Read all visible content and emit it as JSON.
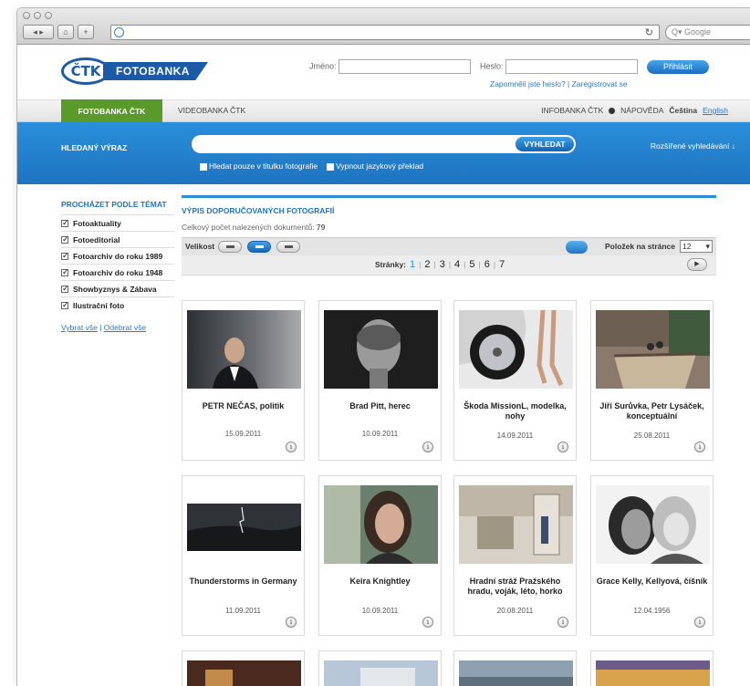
{
  "browser": {
    "search_placeholder": "Q▾ Google"
  },
  "header": {
    "logo_mark": "ČTK",
    "logo_text": "FOTOBANKA",
    "name_label": "Jméno:",
    "password_label": "Heslo:",
    "login_button": "Přihlásit",
    "forgot_link": "Zapomněli jste heslo? | Zaregistrovat se"
  },
  "nav": {
    "tab_active": "FOTOBANKA ČTK",
    "tab_video": "VIDEOBANKA ČTK",
    "infobanka": "INFOBANKA ČTK",
    "help": "NÁPOVĚDA",
    "lang_cz": "Čeština",
    "lang_en": "English"
  },
  "search": {
    "label": "HLEDANÝ VÝRAZ",
    "button": "VYHLEDAT",
    "option1": "Hledat pouze v titulku fotografie",
    "option2": "Vypnout jazykový překlad",
    "advanced": "Rozšířené vyhledávání ↓"
  },
  "sidebar": {
    "title": "PROCHÁZET PODLE TÉMAT",
    "items": [
      "Fotoaktuality",
      "Fotoeditorial",
      "Fotoarchiv do roku 1989",
      "Fotoarchiv do roku 1948",
      "Showbyznys & Zábava",
      "Ilustrační foto"
    ],
    "select_all": "Vybrat vše",
    "deselect_all": "Odebrat vše"
  },
  "main": {
    "title": "VÝPIS DOPORUČOVANÝCH FOTOGRAFIÍ",
    "count_label": "Celkový počet nalezených dokumentů:",
    "count_value": "79",
    "size_label": "Velikost",
    "per_page_label": "Položek na stránce",
    "per_page_value": "12",
    "pages_label": "Stránky:",
    "pages": [
      "1",
      "2",
      "3",
      "4",
      "5",
      "6",
      "7"
    ]
  },
  "photos": [
    {
      "title": "PETR NEČAS, politik",
      "date": "15.09.2011",
      "thumb": "portrait-politician"
    },
    {
      "title": "Brad Pitt, herec",
      "date": "10.09.2011",
      "thumb": "portrait-bw"
    },
    {
      "title": "Škoda MissionL, modelka, nohy",
      "date": "14.09.2011",
      "thumb": "car-wheel"
    },
    {
      "title": "Jiří Surůvka, Petr Lysáček, konceptuální",
      "date": "25.08.2011",
      "thumb": "art-installation"
    },
    {
      "title": "Thunderstorms in Germany",
      "date": "11.09.2011",
      "thumb": "storm"
    },
    {
      "title": "Keira Knightley",
      "date": "10.09.2011",
      "thumb": "portrait-color"
    },
    {
      "title": "Hradní stráž Pražského hradu, voják, léto, horko",
      "date": "20.08.2011",
      "thumb": "guard"
    },
    {
      "title": "Grace Kelly, Kellyová, číšník",
      "date": "12.04.1956",
      "thumb": "couple-bw"
    }
  ]
}
